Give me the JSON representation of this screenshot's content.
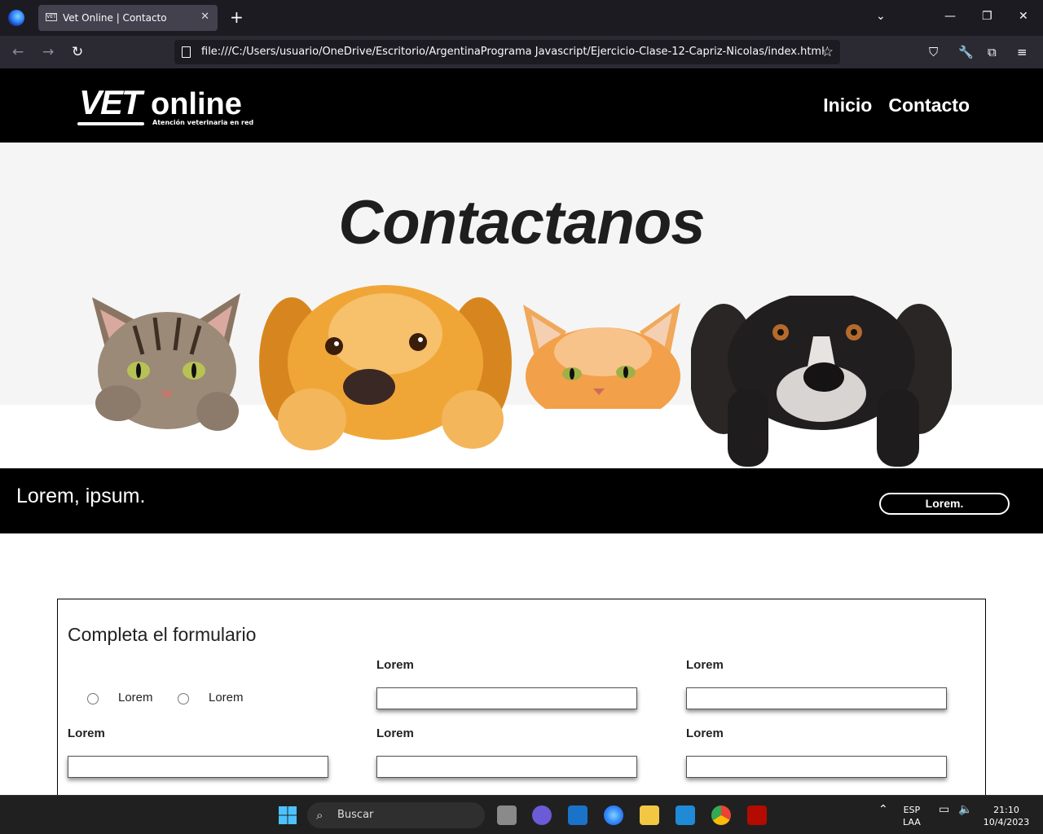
{
  "browser": {
    "tab_title": "Vet Online | Contacto",
    "tab_favicon_text": "VET",
    "url": "file:///C:/Users/usuario/OneDrive/Escritorio/ArgentinaPrograma Javascript/Ejercicio-Clase-12-Capriz-Nicolas/index.html"
  },
  "header": {
    "logo_vet": "VET",
    "logo_online": "online",
    "logo_tagline": "Atención veterinaria en red",
    "nav": [
      "Inicio",
      "Contacto"
    ]
  },
  "hero": {
    "title": "Contactanos"
  },
  "strip": {
    "text": "Lorem, ipsum.",
    "button": "Lorem."
  },
  "form": {
    "title": "Completa el formulario",
    "radios": [
      "Lorem",
      "Lorem"
    ],
    "row1_labels": [
      "Lorem",
      "Lorem"
    ],
    "row2_labels": [
      "Lorem",
      "Lorem",
      "Lorem"
    ]
  },
  "taskbar": {
    "search_placeholder": "Buscar",
    "lang_1": "ESP",
    "lang_2": "LAA",
    "time": "21:10",
    "date": "10/4/2023"
  }
}
